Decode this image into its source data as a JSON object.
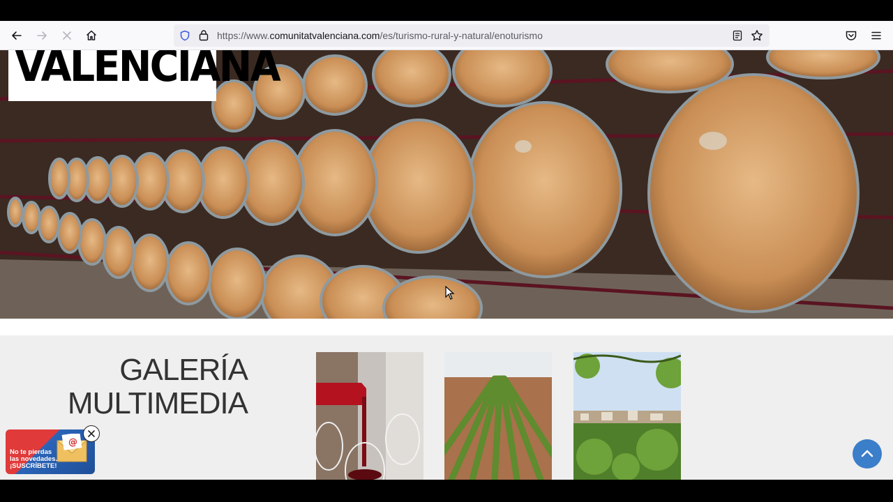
{
  "browser": {
    "url_prefix": "https://www.",
    "url_domain": "comunitatvalenciana.com",
    "url_path": "/es/turismo-rural-y-natural/enoturismo"
  },
  "site": {
    "logo_text": "VALENCIANA"
  },
  "gallery": {
    "title_line1": "GALERÍA",
    "title_line2": "MULTIMEDIA",
    "thumbnails": [
      "wine-pour-photo",
      "vineyard-rows-photo",
      "vine-town-photo"
    ]
  },
  "newsletter": {
    "line1": "No te pierdas",
    "line2": "las novedades.",
    "line3": "¡SUSCRÍBETE!"
  },
  "colors": {
    "accent": "#3b7ec9",
    "newsletter_red": "#e03a3a",
    "newsletter_blue": "#2a64b8"
  }
}
